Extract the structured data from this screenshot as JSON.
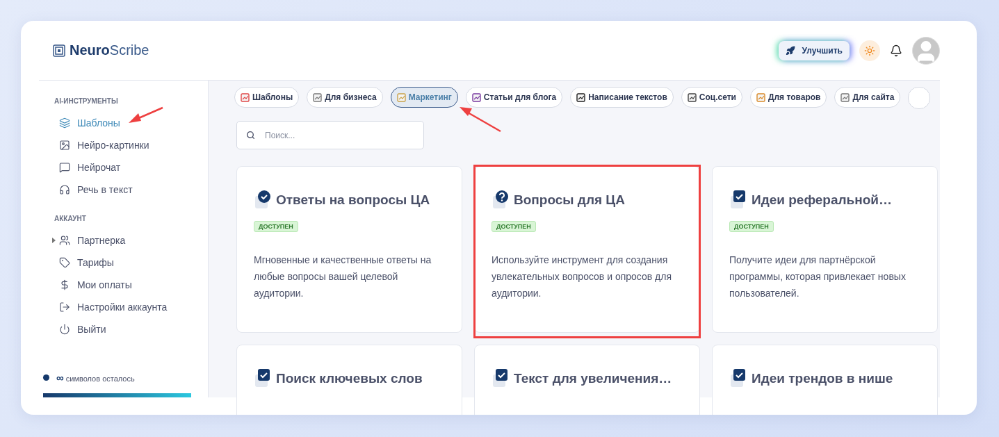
{
  "brand": {
    "name_bold": "Neuro",
    "name_light": "Scribe"
  },
  "header": {
    "upgrade_button": "Улучшить"
  },
  "sidebar": {
    "sections": [
      {
        "title": "AI-ИНСТРУМЕНТЫ",
        "items": [
          {
            "label": "Шаблоны",
            "selected": true,
            "kind": "link"
          },
          {
            "label": "Нейро-картинки",
            "selected": false,
            "kind": "link"
          },
          {
            "label": "Нейрочат",
            "selected": false,
            "kind": "link"
          },
          {
            "label": "Речь в текст",
            "selected": false,
            "kind": "link"
          }
        ]
      },
      {
        "title": "АККАУНТ",
        "items": [
          {
            "label": "Партнерка",
            "selected": false,
            "kind": "expandable",
            "expanded": false
          },
          {
            "label": "Тарифы",
            "selected": false,
            "kind": "link"
          },
          {
            "label": "Мои оплаты",
            "selected": false,
            "kind": "link"
          },
          {
            "label": "Настройки аккаунта",
            "selected": false,
            "kind": "link"
          },
          {
            "label": "Выйти",
            "selected": false,
            "kind": "link"
          }
        ]
      }
    ],
    "credits": {
      "amount": "∞",
      "label": "символов осталось",
      "level": 1
    }
  },
  "categories": [
    {
      "label": "Шаблоны",
      "selected": false
    },
    {
      "label": "Для бизнеса",
      "selected": false
    },
    {
      "label": "Маркетинг",
      "selected": true
    },
    {
      "label": "Статьи для блога",
      "selected": false
    },
    {
      "label": "Написание текстов",
      "selected": false
    },
    {
      "label": "Соц.сети",
      "selected": false
    },
    {
      "label": "Для товаров",
      "selected": false
    },
    {
      "label": "Для сайта",
      "selected": false
    }
  ],
  "search": {
    "placeholder": "Поиск..."
  },
  "cards": [
    {
      "title": "Ответы на вопросы ЦА",
      "kind": "check-circle",
      "status": "ДОСТУПЕН",
      "description": "Мгновенные и качественные ответы на любые вопросы вашей целевой аудитории.",
      "highlighted": false
    },
    {
      "title": "Вопросы для ЦА",
      "kind": "question",
      "status": "ДОСТУПЕН",
      "description": "Используйте инструмент для создания увлекательных вопросов и опросов для аудитории.",
      "highlighted": true
    },
    {
      "title": "Идеи реферальной…",
      "kind": "check-box",
      "status": "ДОСТУПЕН",
      "description": "Получите идеи для партнёрской программы, которая привлекает новых пользователей.",
      "highlighted": false
    },
    {
      "title": "Поиск ключевых слов",
      "kind": "check-box",
      "highlighted": false
    },
    {
      "title": "Текст для увеличения…",
      "kind": "check-box",
      "highlighted": false
    },
    {
      "title": "Идеи трендов в нише",
      "kind": "check-box",
      "highlighted": false
    }
  ]
}
